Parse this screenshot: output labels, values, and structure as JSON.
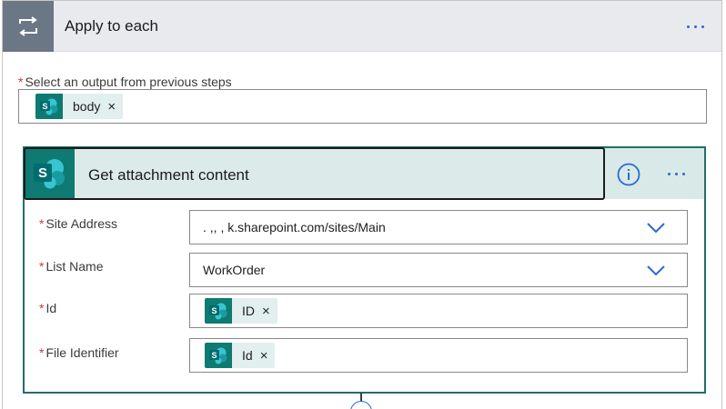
{
  "loop": {
    "title": "Apply to each",
    "select_label": "Select an output from previous steps",
    "token": {
      "label": "body",
      "remove": "×"
    }
  },
  "action": {
    "title": "Get attachment content",
    "fields": {
      "site_address": {
        "label": "Site Address",
        "value": ".                          ,,      ,    k.sharepoint.com/sites/Main"
      },
      "list_name": {
        "label": "List Name",
        "value": "WorkOrder"
      },
      "id": {
        "label": "Id",
        "token": "ID",
        "remove": "×"
      },
      "file_identifier": {
        "label": "File Identifier",
        "token": "Id",
        "remove": "×"
      }
    }
  },
  "required_mark": "*",
  "sharepoint_letter": "S",
  "colors": {
    "loop_icon_bg": "#6b7785",
    "sharepoint": "#0e7a71",
    "accent": "#2a6bd0",
    "required": "#d13438",
    "action_border": "#216f6a"
  },
  "icons": {
    "loop": "loop-icon",
    "sharepoint": "sharepoint-icon",
    "info": "info-icon",
    "chevron": "chevron-down-icon",
    "more": "more-icon"
  }
}
